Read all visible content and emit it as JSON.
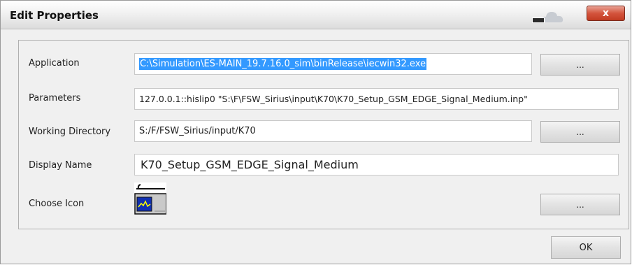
{
  "window": {
    "title": "Edit Properties",
    "close_label": "x"
  },
  "form": {
    "application": {
      "label": "Application",
      "value": "C:\\Simulation\\ES-MAIN_19.7.16.0_sim\\binRelease\\iecwin32.exe",
      "browse_label": "..."
    },
    "parameters": {
      "label": "Parameters",
      "value": "127.0.0.1::hislip0 \"S:\\F\\FSW_Sirius\\input\\K70\\K70_Setup_GSM_EDGE_Signal_Medium.inp\""
    },
    "working_directory": {
      "label": "Working Directory",
      "value": "S:/F/FSW_Sirius/input/K70",
      "browse_label": "..."
    },
    "display_name": {
      "label": "Display Name",
      "value": "K70_Setup_GSM_EDGE_Signal_Medium"
    },
    "choose_icon": {
      "label": "Choose Icon",
      "icon": "spectrum-analyzer-icon",
      "browse_label": "..."
    }
  },
  "footer": {
    "ok_label": "OK"
  }
}
